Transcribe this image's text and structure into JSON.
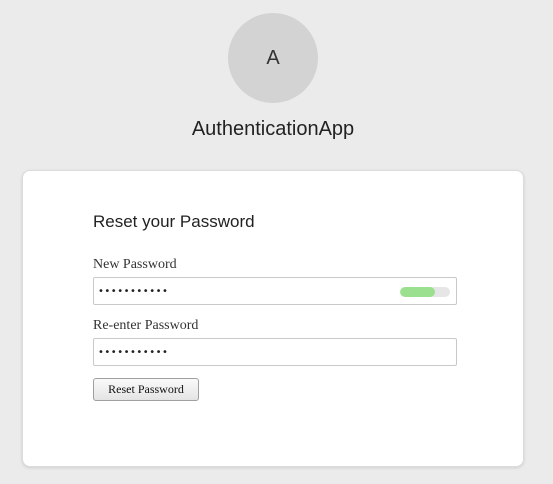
{
  "header": {
    "avatar_letter": "A",
    "app_name": "AuthenticationApp"
  },
  "form": {
    "title": "Reset your Password",
    "new_password": {
      "label": "New Password",
      "value": "•••••••••••",
      "strength": 0.7,
      "strength_color": "#9be08e"
    },
    "confirm_password": {
      "label": "Re-enter Password",
      "value": "•••••••••••"
    },
    "submit_label": "Reset Password"
  }
}
